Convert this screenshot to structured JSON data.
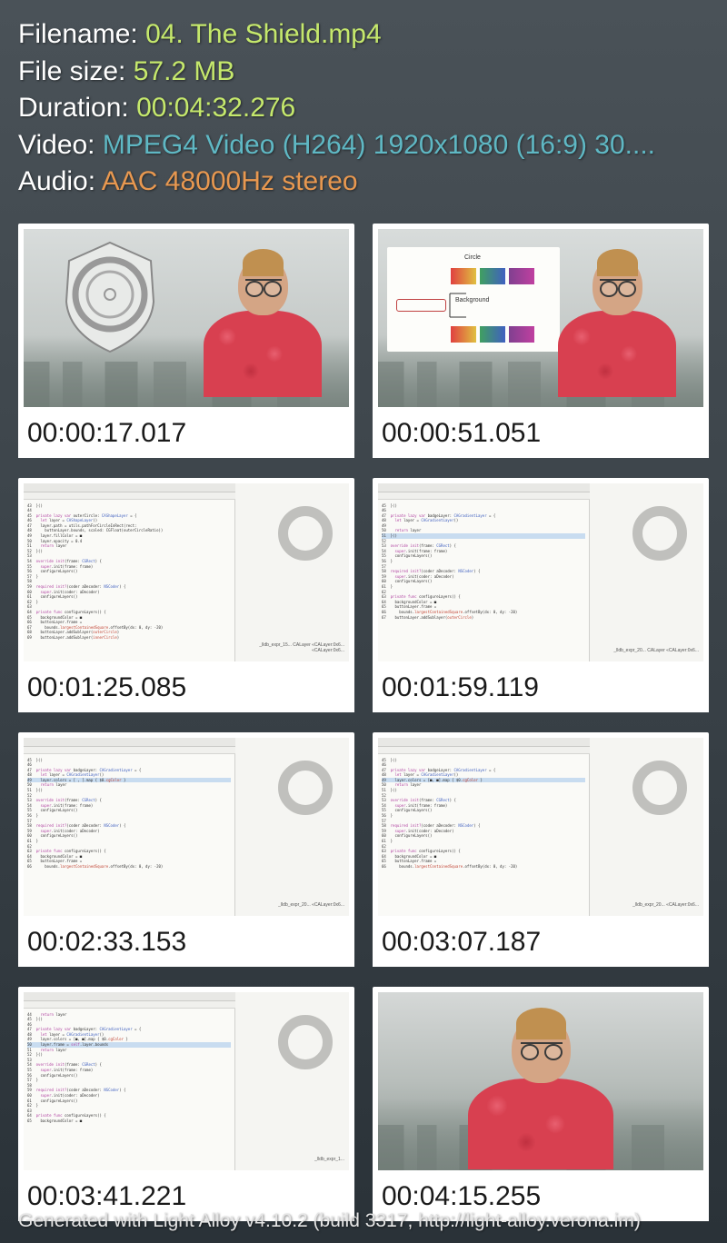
{
  "meta": {
    "filename_label": "Filename: ",
    "filename_value": "04. The Shield.mp4",
    "filesize_label": "File size: ",
    "filesize_value": "57.2 MB",
    "duration_label": "Duration: ",
    "duration_value": "00:04:32.276",
    "video_label": "Video: ",
    "video_value": "MPEG4 Video (H264) 1920x1080 (16:9) 30....",
    "audio_label": "Audio: ",
    "audio_value": "AAC 48000Hz stereo"
  },
  "thumbs": [
    {
      "time": "00:00:17.017"
    },
    {
      "time": "00:00:51.051"
    },
    {
      "time": "00:01:25.085"
    },
    {
      "time": "00:01:59.119"
    },
    {
      "time": "00:02:33.153"
    },
    {
      "time": "00:03:07.187"
    },
    {
      "time": "00:03:41.221"
    },
    {
      "time": "00:04:15.255"
    }
  ],
  "diagram": {
    "top_text": "Circle",
    "bottom_text": "Background"
  },
  "code_labels": {
    "t3": "_lldb_expr_15...\nCALayer\n«CALayer:0x6...\n«CALayer:0x6...",
    "t4": "_lldb_expr_20...\nCALayer\n«CALayer:0x6...",
    "t5": "_lldb_expr_20...\n«CALayer:0x6...",
    "t6": "_lldb_expr_20...\n«CALayer:0x6...",
    "t7": "_lldb_expr_1..."
  },
  "footer": "Generated with Light Alloy v4.10.2 (build 3317, http://light-alloy.verona.im)"
}
